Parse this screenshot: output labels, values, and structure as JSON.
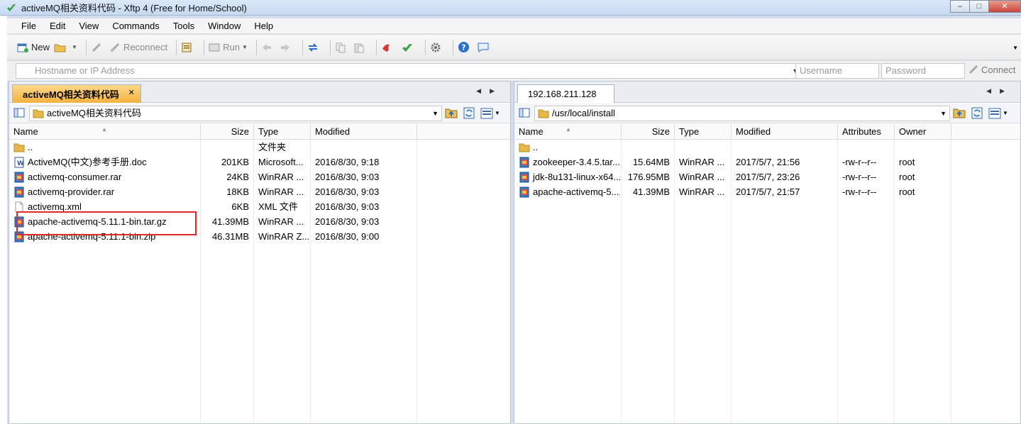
{
  "window": {
    "title": "activeMQ相关资料代码 - Xftp 4 (Free for Home/School)",
    "app_icon": "xftp-icon",
    "minimize": "–",
    "maximize": "□",
    "close": "✕"
  },
  "menu": [
    "File",
    "Edit",
    "View",
    "Commands",
    "Tools",
    "Window",
    "Help"
  ],
  "toolbar": {
    "new_label": "New",
    "reconnect_label": "Reconnect",
    "run_label": "Run"
  },
  "address_bar": {
    "host_placeholder": "Hostname or IP Address",
    "username_placeholder": "Username",
    "password_placeholder": "Password",
    "connect_label": "Connect"
  },
  "local": {
    "tab_label": "activeMQ相关资料代码",
    "tab_close": "✕",
    "path": "activeMQ相关资料代码",
    "columns": {
      "name": "Name",
      "size": "Size",
      "type": "Type",
      "modified": "Modified"
    },
    "files": [
      {
        "name": "..",
        "size": "",
        "type": "文件夹",
        "modified": "",
        "icon": "folder"
      },
      {
        "name": "ActiveMQ(中文)参考手册.doc",
        "size": "201KB",
        "type": "Microsoft...",
        "modified": "2016/8/30, 9:18",
        "icon": "doc"
      },
      {
        "name": "activemq-consumer.rar",
        "size": "24KB",
        "type": "WinRAR ...",
        "modified": "2016/8/30, 9:03",
        "icon": "rar"
      },
      {
        "name": "activemq-provider.rar",
        "size": "18KB",
        "type": "WinRAR ...",
        "modified": "2016/8/30, 9:03",
        "icon": "rar"
      },
      {
        "name": "activemq.xml",
        "size": "6KB",
        "type": "XML 文件",
        "modified": "2016/8/30, 9:03",
        "icon": "xml"
      },
      {
        "name": "apache-activemq-5.11.1-bin.tar.gz",
        "size": "41.39MB",
        "type": "WinRAR ...",
        "modified": "2016/8/30, 9:03",
        "icon": "rar"
      },
      {
        "name": "apache-activemq-5.11.1-bin.zip",
        "size": "46.31MB",
        "type": "WinRAR Z...",
        "modified": "2016/8/30, 9:00",
        "icon": "rar"
      }
    ]
  },
  "remote": {
    "tab_label": "192.168.211.128",
    "path": "/usr/local/install",
    "columns": {
      "name": "Name",
      "size": "Size",
      "type": "Type",
      "modified": "Modified",
      "attributes": "Attributes",
      "owner": "Owner"
    },
    "files": [
      {
        "name": "..",
        "size": "",
        "type": "",
        "modified": "",
        "attributes": "",
        "owner": "",
        "icon": "folder"
      },
      {
        "name": "zookeeper-3.4.5.tar...",
        "size": "15.64MB",
        "type": "WinRAR ...",
        "modified": "2017/5/7, 21:56",
        "attributes": "-rw-r--r--",
        "owner": "root",
        "icon": "rar"
      },
      {
        "name": "jdk-8u131-linux-x64...",
        "size": "176.95MB",
        "type": "WinRAR ...",
        "modified": "2017/5/7, 23:26",
        "attributes": "-rw-r--r--",
        "owner": "root",
        "icon": "rar"
      },
      {
        "name": "apache-activemq-5....",
        "size": "41.39MB",
        "type": "WinRAR ...",
        "modified": "2017/5/7, 21:57",
        "attributes": "-rw-r--r--",
        "owner": "root",
        "icon": "rar"
      }
    ]
  },
  "colors": {
    "active_tab": "#f4b23e",
    "highlight_box": "#e02a2a",
    "folder": "#e8b84a",
    "rar_icon": "#3a78c4"
  }
}
